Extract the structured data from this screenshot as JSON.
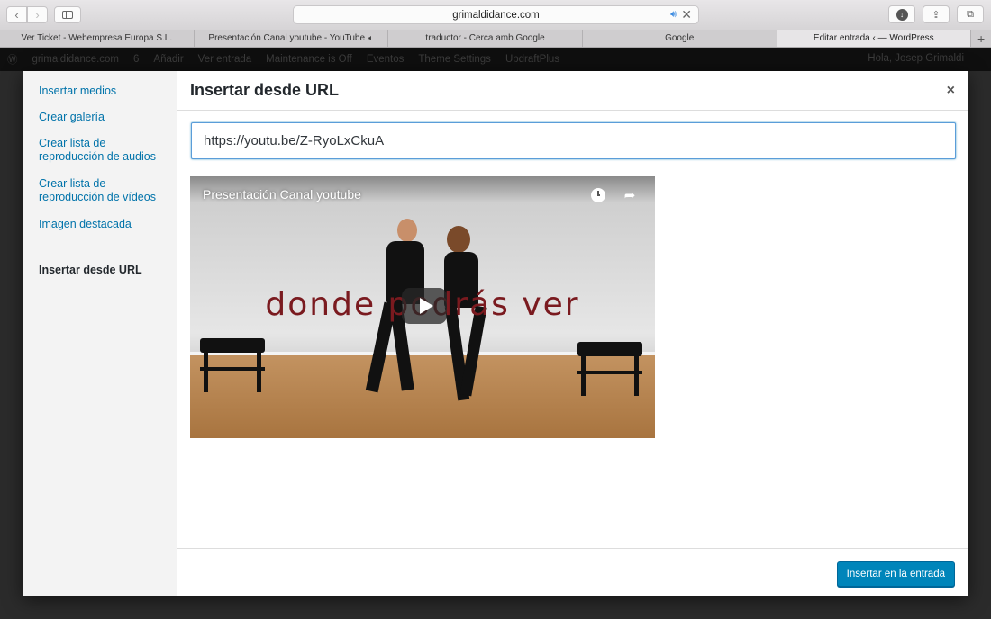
{
  "browser": {
    "address": "grimaldidance.com",
    "tabs": [
      {
        "label": "Ver Ticket - Webempresa Europa S.L.",
        "active": false,
        "audio": false
      },
      {
        "label": "Presentación Canal youtube - YouTube",
        "active": false,
        "audio": true
      },
      {
        "label": "traductor - Cerca amb Google",
        "active": false,
        "audio": false
      },
      {
        "label": "Google",
        "active": false,
        "audio": false
      },
      {
        "label": "Editar entrada ‹ — WordPress",
        "active": true,
        "audio": false
      }
    ],
    "new_tab_label": "+"
  },
  "adminbar": {
    "site": "grimaldidance.com",
    "updates": "6",
    "add_new": "Añadir",
    "view_post": "Ver entrada",
    "maintenance": "Maintenance is Off",
    "events": "Eventos",
    "theme_settings": "Theme Settings",
    "updraft": "UpdraftPlus",
    "greeting": "Hola, Josep Grimaldi"
  },
  "modal": {
    "title": "Insertar desde URL",
    "close_label": "×",
    "menu": [
      "Insertar medios",
      "Crear galería",
      "Crear lista de reproducción de audios",
      "Crear lista de reproducción de vídeos",
      "Imagen destacada",
      "Insertar desde URL"
    ],
    "url_value": "https://youtu.be/Z-RyoLxCkuA",
    "video": {
      "title": "Presentación Canal youtube",
      "overlay_text": "donde podrás ver"
    },
    "insert_button": "Insertar en la entrada"
  },
  "colors": {
    "link": "#0073aa",
    "primary_button": "#0085ba",
    "overlay_text": "#7a1a1f"
  }
}
